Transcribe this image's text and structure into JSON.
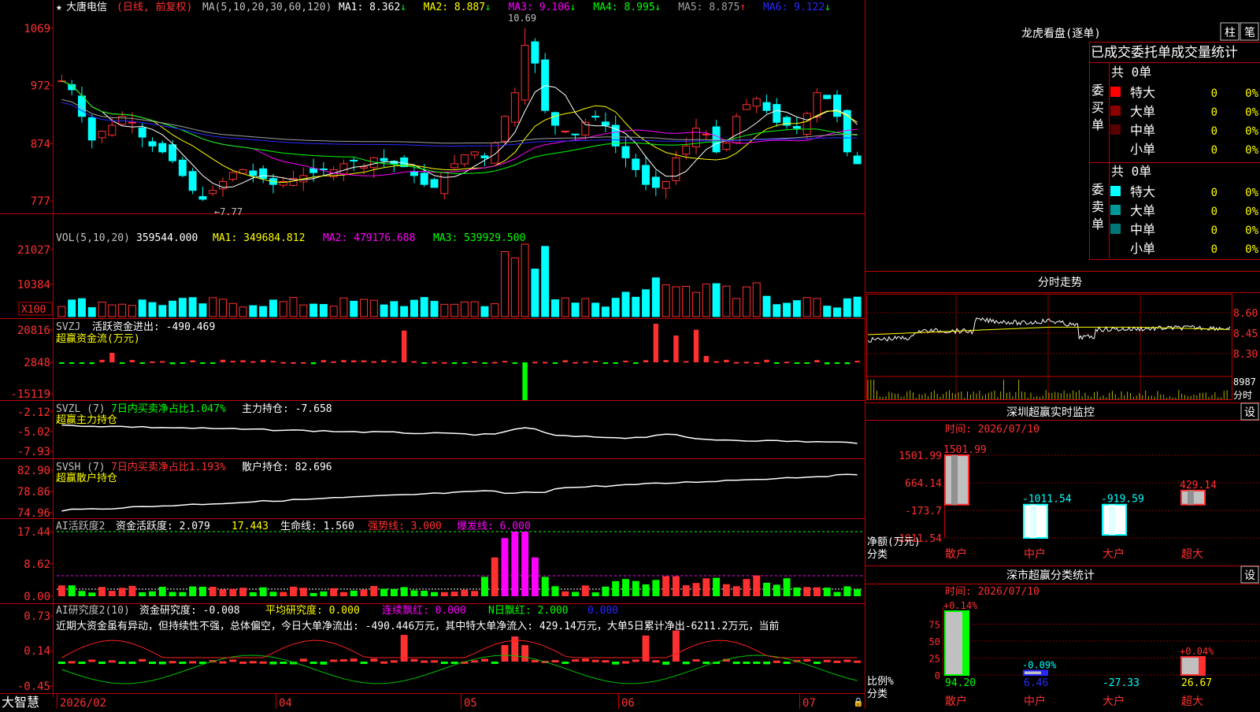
{
  "colors": {
    "up": "#ff3030",
    "down": "#00ffff",
    "red_frame": "#c00000",
    "ma1": "#ffffff",
    "ma2": "#ffff00",
    "ma3": "#ff00ff",
    "ma4": "#00ff00",
    "ma5": "#a0a0a0",
    "ma6": "#2828ff",
    "green": "#00ff00",
    "magenta": "#ff00ff"
  },
  "header": {
    "star": "★",
    "stock": "大唐电信",
    "period": "(日线, 前复权)",
    "ma_title": "MA(5,10,20,30,60,120)",
    "ma": [
      {
        "label": "MA1:",
        "value": "8.362",
        "arrow": "↓"
      },
      {
        "label": "MA2:",
        "value": "8.887",
        "arrow": "↓"
      },
      {
        "label": "MA3:",
        "value": "9.106",
        "arrow": "↓"
      },
      {
        "label": "MA4:",
        "value": "8.995",
        "arrow": "↓"
      },
      {
        "label": "MA5:",
        "value": "8.875",
        "arrow": "↑"
      },
      {
        "label": "MA6:",
        "value": "9.122",
        "arrow": "↓"
      }
    ]
  },
  "price_panel": {
    "yticks": [
      "1069",
      "972",
      "874",
      "777"
    ],
    "high_annot": "10.69",
    "low_annot": "←7.77"
  },
  "vol_panel": {
    "title": "VOL(5,10,20)",
    "val": "359544.000",
    "ma1": "MA1: 349684.812",
    "ma2": "MA2: 479176.688",
    "ma3": "MA3: 539929.500",
    "yticks": [
      "21027",
      "10384"
    ],
    "unit": "X100"
  },
  "svzj_panel": {
    "title": "SVZJ",
    "label": "活跃资金进出: -490.469",
    "sub": "超赢资金流(万元)",
    "yticks": [
      "20816",
      "2848",
      "-15119"
    ]
  },
  "svzl_panel": {
    "title": "SVZL (7)",
    "ratio": "7日内买卖净占比1.047%",
    "hold": "主力持仓: -7.658",
    "sub": "超赢主力持仓",
    "yticks": [
      "-2.12",
      "-5.02",
      "-7.93"
    ]
  },
  "svsh_panel": {
    "title": "SVSH (7)",
    "ratio": "7日内买卖净占比1.193%",
    "hold": "散户持仓: 82.696",
    "sub": "超赢散户持仓",
    "yticks": [
      "82.90",
      "78.86",
      "74.96"
    ]
  },
  "ai1_panel": {
    "title": "AI活跃度2",
    "f1": "资金活跃度: 2.079",
    "f2": "17.443",
    "f3": "生命线: 1.560",
    "f4": "强势线: 3.000",
    "f5": "爆发线: 6.000",
    "yticks": [
      "17.44",
      "8.62",
      "0.00"
    ]
  },
  "ai2_panel": {
    "title": "AI研究度2(10)",
    "f1": "资金研究度: -0.008",
    "f2": "平均研究度: 0.000",
    "f3": "连续飘红: 0.000",
    "f4": "N日飘红: 2.000",
    "f5": "0.000",
    "text": "近期大资金虽有异动，但持续性不强，总体偏空，今日大单净流出: -490.446万元，其中特大单净流入: 429.14万元，大单5日累计净出-6211.2万元，当前",
    "yticks": [
      "0.73",
      "0.14",
      "-0.45"
    ]
  },
  "xaxis": {
    "brand": "大智慧",
    "labels": [
      "2026/02",
      "04",
      "05",
      "06",
      "07"
    ]
  },
  "longhu": {
    "title": "龙虎看盘(逐单)",
    "btn1": "柱",
    "btn2": "笔",
    "header": "已成交委托单成交量统计",
    "buy": {
      "side": "委买单",
      "total": "共 0单",
      "rows": [
        {
          "name": "特大",
          "count": "0",
          "pct": "0%",
          "color": "#ff0000"
        },
        {
          "name": "大单",
          "count": "0",
          "pct": "0%",
          "color": "#8b0000"
        },
        {
          "name": "中单",
          "count": "0",
          "pct": "0%",
          "color": "#5a0000"
        },
        {
          "name": "小单",
          "count": "0",
          "pct": "0%",
          "color": "#000000"
        }
      ]
    },
    "sell": {
      "side": "委卖单",
      "total": "共 0单",
      "rows": [
        {
          "name": "特大",
          "count": "0",
          "pct": "0%",
          "color": "#00ffff"
        },
        {
          "name": "大单",
          "count": "0",
          "pct": "0%",
          "color": "#009999"
        },
        {
          "name": "中单",
          "count": "0",
          "pct": "0%",
          "color": "#007777"
        },
        {
          "name": "小单",
          "count": "0",
          "pct": "0%",
          "color": "#000000"
        }
      ]
    }
  },
  "intraday": {
    "title": "分时走势",
    "yticks": [
      "8.60",
      "8.45",
      "8.30"
    ],
    "vol_max": "8987",
    "vol_label": "分时"
  },
  "monitor": {
    "title": "深圳超赢实时监控",
    "btn": "设",
    "time": "时间: 2026/07/10",
    "yticks": [
      "1501.99",
      "664.14",
      "-173.7",
      "-1011.54"
    ],
    "ylabel": "净额(万元)",
    "xlabel": "分类",
    "bars": [
      {
        "cat": "散户",
        "value": 1501.99,
        "label": "1501.99"
      },
      {
        "cat": "中户",
        "value": -1011.54,
        "label": "-1011.54"
      },
      {
        "cat": "大户",
        "value": -919.59,
        "label": "-919.59"
      },
      {
        "cat": "超大",
        "value": 429.14,
        "label": "429.14"
      }
    ]
  },
  "classify": {
    "title": "深市超赢分类统计",
    "btn": "设",
    "time": "时间: 2026/07/10",
    "yticks": [
      "75",
      "50",
      "25",
      "0"
    ],
    "ylabel": "比例%",
    "xlabel": "分类",
    "bars": [
      {
        "cat": "散户",
        "value": 94.2,
        "label": "94.20",
        "delta": "+0.14%"
      },
      {
        "cat": "中户",
        "value": 6.46,
        "label": "6.46",
        "delta": "-0.09%"
      },
      {
        "cat": "大户",
        "value": -27.33,
        "label": "-27.33",
        "delta": ""
      },
      {
        "cat": "超大",
        "value": 26.67,
        "label": "26.67",
        "delta": "+0.04%"
      }
    ]
  },
  "chart_data": {
    "type": "candlestick",
    "n": 80,
    "dates_axis": [
      "2026/02",
      "04",
      "05",
      "06",
      "07"
    ],
    "close": [
      9.8,
      9.65,
      9.2,
      8.8,
      8.95,
      9.05,
      9.2,
      9.1,
      8.85,
      8.7,
      8.6,
      8.45,
      8.2,
      7.95,
      7.8,
      7.95,
      8.1,
      8.25,
      8.3,
      8.2,
      8.15,
      8.05,
      8.1,
      8.15,
      8.2,
      8.25,
      8.3,
      8.3,
      8.4,
      8.45,
      8.35,
      8.5,
      8.45,
      8.4,
      8.35,
      8.2,
      8.05,
      8.0,
      8.25,
      8.4,
      8.55,
      8.6,
      8.5,
      8.75,
      9.2,
      9.6,
      10.4,
      10.1,
      9.3,
      9.05,
      8.95,
      8.9,
      9.1,
      9.2,
      9.05,
      8.7,
      8.5,
      8.3,
      8.05,
      8.0,
      8.1,
      8.5,
      8.7,
      9.0,
      8.9,
      8.6,
      8.75,
      9.2,
      9.4,
      9.5,
      9.3,
      9.1,
      9.05,
      9.0,
      9.25,
      9.6,
      9.5,
      9.2,
      8.6,
      8.4
    ],
    "ylim": [
      7.6,
      10.9
    ]
  }
}
